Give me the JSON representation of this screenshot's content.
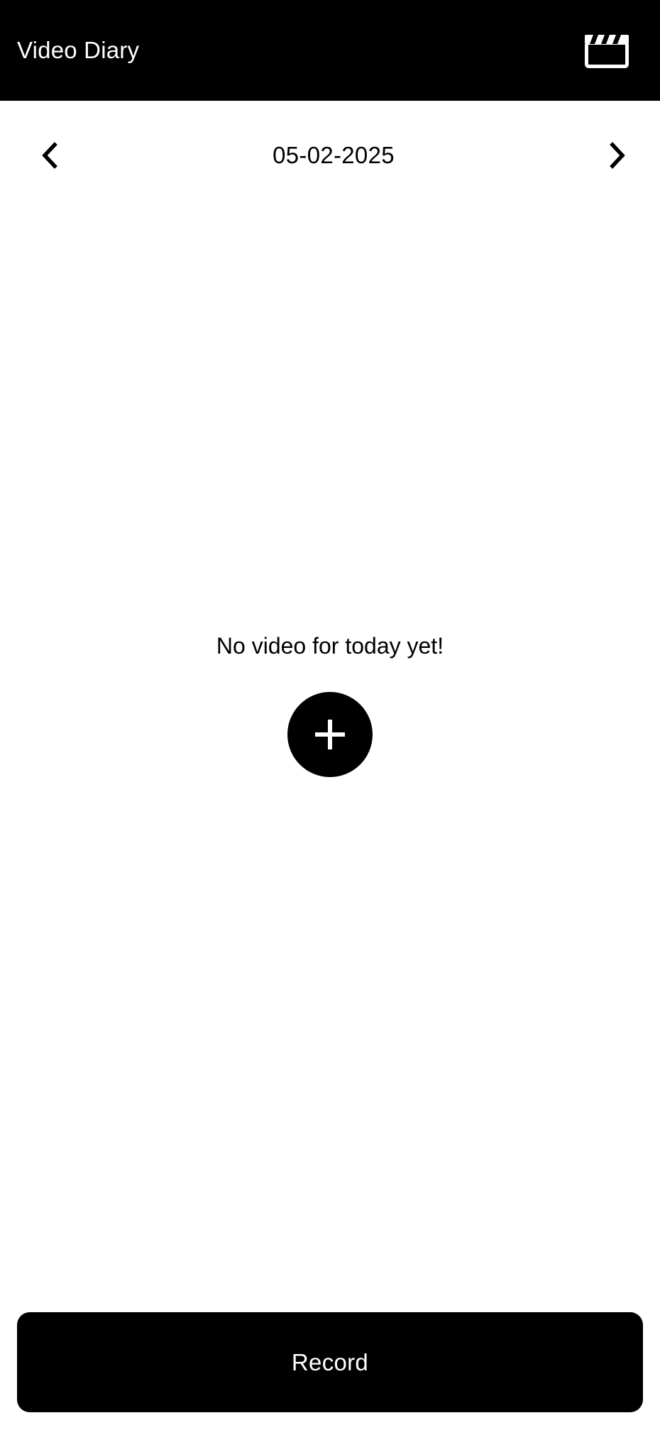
{
  "appbar": {
    "title": "Video Diary",
    "action_icon": "clapperboard-icon"
  },
  "date_nav": {
    "prev_icon": "chevron-left-icon",
    "date": "05-02-2025",
    "next_icon": "chevron-right-icon"
  },
  "empty_state": {
    "message": "No video for today yet!",
    "add_icon": "plus-icon"
  },
  "record_button": {
    "label": "Record"
  },
  "colors": {
    "background": "#ffffff",
    "primary": "#000000",
    "on_primary": "#ffffff"
  }
}
